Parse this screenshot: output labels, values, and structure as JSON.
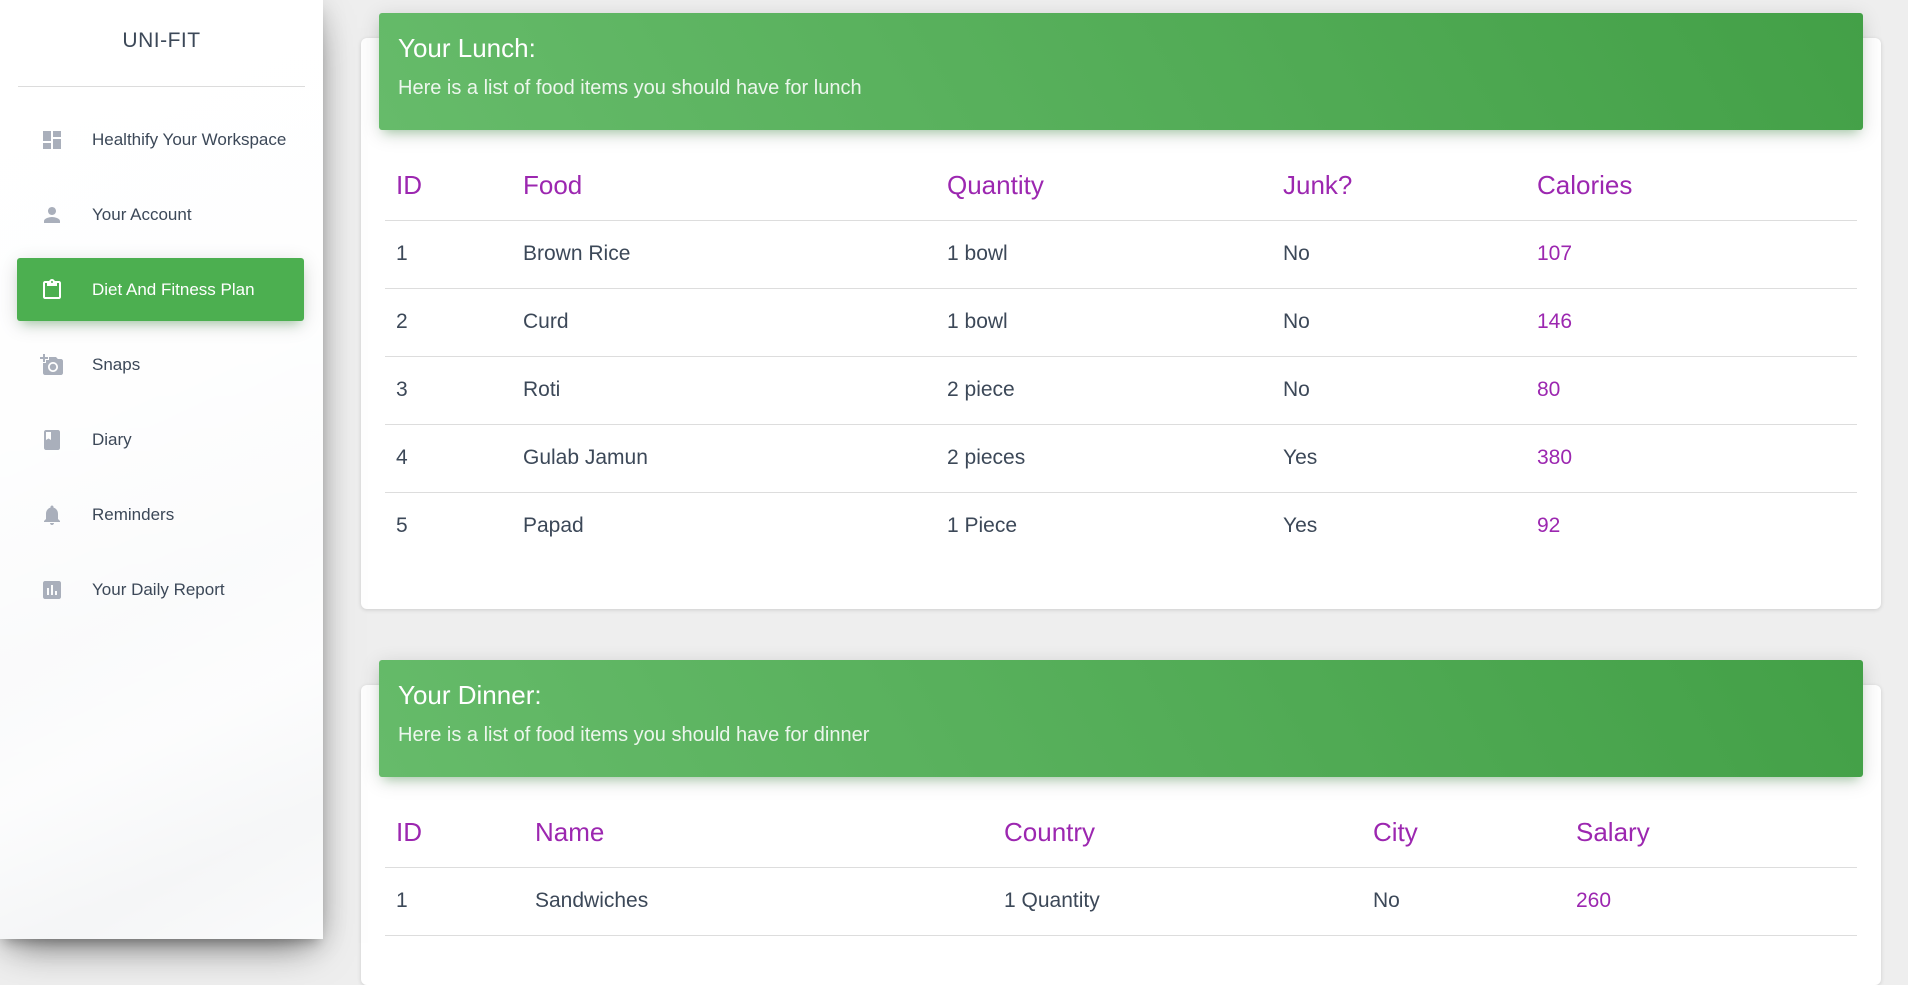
{
  "sidebar": {
    "brand": "UNI-FIT",
    "items": [
      {
        "label": "Healthify Your Workspace",
        "icon": "dashboard-icon",
        "active": false
      },
      {
        "label": "Your Account",
        "icon": "person-icon",
        "active": false
      },
      {
        "label": "Diet And Fitness Plan",
        "icon": "clipboard-icon",
        "active": true
      },
      {
        "label": "Snaps",
        "icon": "add-photo-icon",
        "active": false
      },
      {
        "label": "Diary",
        "icon": "book-icon",
        "active": false
      },
      {
        "label": "Reminders",
        "icon": "bell-icon",
        "active": false
      },
      {
        "label": "Your Daily Report",
        "icon": "bar-chart-icon",
        "active": false
      }
    ]
  },
  "colors": {
    "accent_green": "#4caf50",
    "header_purple": "#9c27b0",
    "text_dark": "#3c4858"
  },
  "lunch": {
    "title": "Your Lunch:",
    "subtitle": "Here is a list of food items you should have for lunch",
    "columns": [
      "ID",
      "Food",
      "Quantity",
      "Junk?",
      "Calories"
    ],
    "rows": [
      [
        "1",
        "Brown Rice",
        "1 bowl",
        "No",
        "107"
      ],
      [
        "2",
        "Curd",
        "1 bowl",
        "No",
        "146"
      ],
      [
        "3",
        "Roti",
        "2 piece",
        "No",
        "80"
      ],
      [
        "4",
        "Gulab Jamun",
        "2 pieces",
        "Yes",
        "380"
      ],
      [
        "5",
        "Papad",
        "1 Piece",
        "Yes",
        "92"
      ]
    ]
  },
  "dinner": {
    "title": "Your Dinner:",
    "subtitle": "Here is a list of food items you should have for dinner",
    "columns": [
      "ID",
      "Name",
      "Country",
      "City",
      "Salary"
    ],
    "rows": [
      [
        "1",
        "Sandwiches",
        "1 Quantity",
        "No",
        "260"
      ]
    ]
  }
}
